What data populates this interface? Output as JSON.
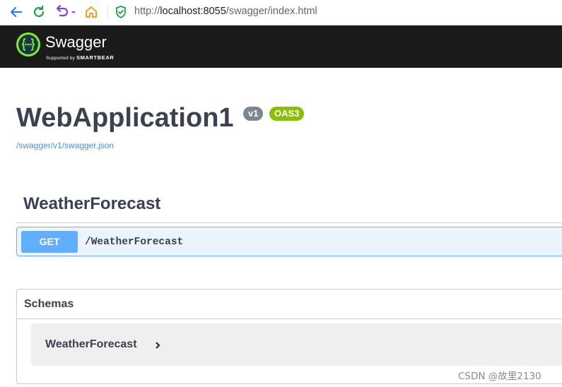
{
  "browser": {
    "url_scheme": "http://",
    "url_host": "localhost:8055",
    "url_path": "/swagger/index.html"
  },
  "topbar": {
    "logo_text": "Swagger",
    "logo_sub_prefix": "Supported by ",
    "logo_sub_brand": "SMARTBEAR"
  },
  "info": {
    "title": "WebApplication1",
    "version_badge": "v1",
    "oas_badge": "OAS3",
    "spec_url": "/swagger/v1/swagger.json"
  },
  "tag": {
    "name": "WeatherForecast",
    "operations": [
      {
        "method": "GET",
        "path": "/WeatherForecast"
      }
    ]
  },
  "schemas": {
    "title": "Schemas",
    "models": [
      {
        "name": "WeatherForecast"
      }
    ]
  },
  "watermark": "CSDN @故里2130",
  "colors": {
    "topbar_bg": "#1b1b1b",
    "logo_green": "#85ea2d",
    "get_blue": "#61affe",
    "get_bg": "#ebf3fb",
    "oas_green": "#89bf04",
    "version_gray": "#7d8492",
    "link_blue": "#4990e2"
  }
}
